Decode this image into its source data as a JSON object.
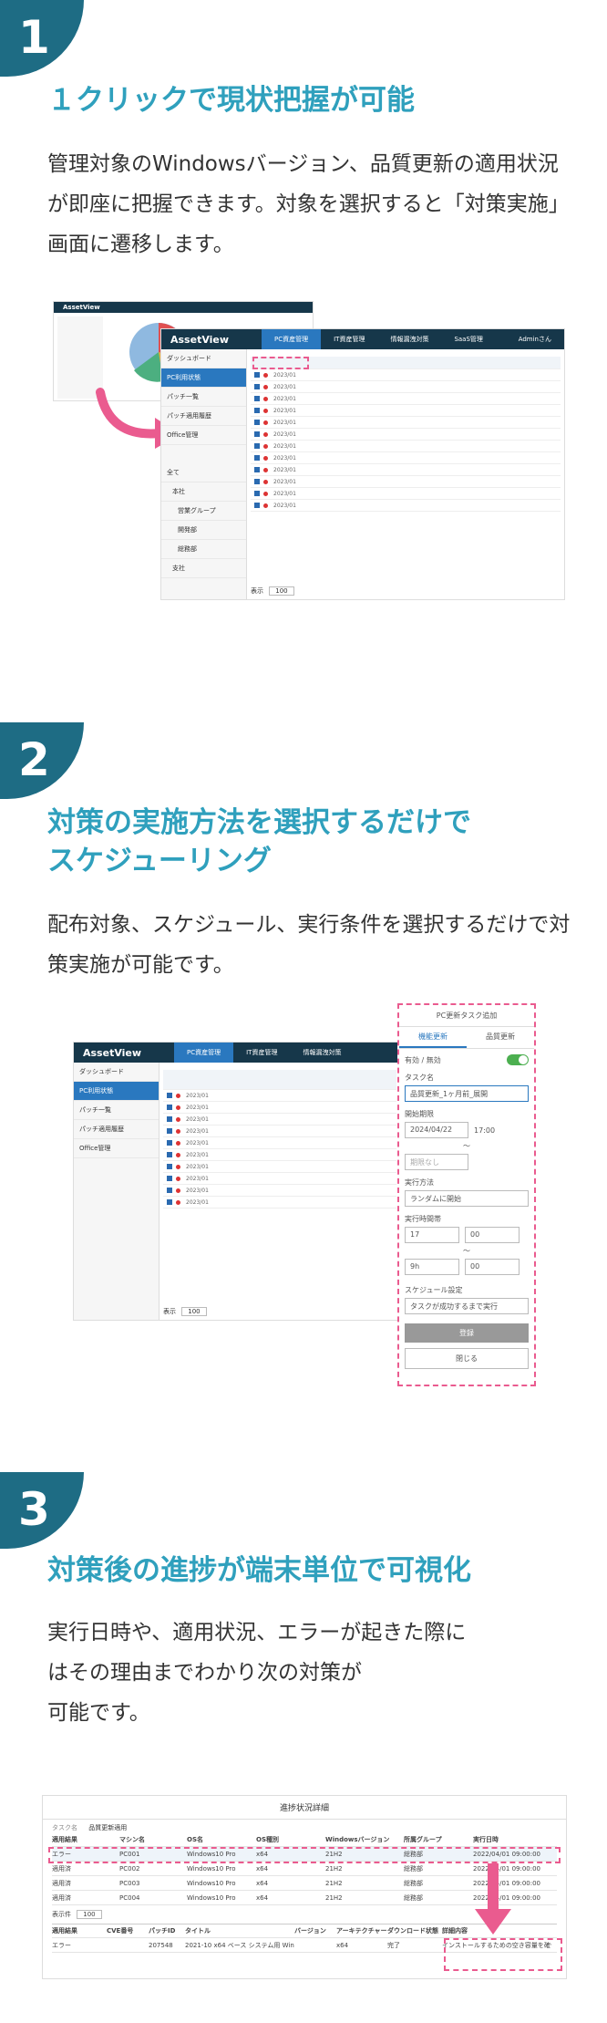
{
  "sections": [
    {
      "number": "1",
      "heading": "１クリックで現状把握が可能",
      "body": "管理対象のWindowsバージョン、品質更新の適用状況が即座に把握できます。対象を選択すると「対策実施」画面に遷移します。"
    },
    {
      "number": "2",
      "heading_line1": "対策の実施方法を選択するだけで",
      "heading_line2": "スケジューリング",
      "body": "配布対象、スケジュール、実行条件を選択するだけで対策実施が可能です。"
    },
    {
      "number": "3",
      "heading": "対策後の進捗が端末単位で可視化",
      "body_line1": "実行日時や、適用状況、エラーが起きた際に",
      "body_line2": "はその理由までわかり次の対策が",
      "body_line3": "可能です。"
    }
  ],
  "app": {
    "logo": "AssetView",
    "tabs": [
      "PC資産管理",
      "IT資産管理",
      "情報漏洩対策",
      "SaaS管理"
    ],
    "user": "Adminさん",
    "sidebar": [
      "ダッシュボード",
      "PC利用状態",
      "パッチ一覧",
      "パッチ適用履歴",
      "Office管理"
    ],
    "tree": [
      "全て",
      "本社",
      "営業グループ",
      "開発部",
      "総務部",
      "支社"
    ],
    "rows": [
      "2023/01",
      "2023/01",
      "2023/01",
      "2023/01",
      "2023/01",
      "2023/01",
      "2023/01",
      "2023/01",
      "2023/01",
      "2023/01",
      "2023/01",
      "2023/01"
    ],
    "footer_label": "表示",
    "footer_value": "100"
  },
  "task_panel": {
    "title": "PC更新タスク追加",
    "tab_active": "機能更新",
    "tab_other": "品質更新",
    "enable_label": "有効 / 無効",
    "task_name_label": "タスク名",
    "task_name_value": "品質更新_1ヶ月前_展開",
    "start_label": "開始期限",
    "start_date": "2024/04/22",
    "start_time": "17:00",
    "tilde": "〜",
    "end_placeholder": "期限なし",
    "exec_label": "実行方法",
    "exec_value": "ランダムに開始",
    "time_label": "実行時間帯",
    "hour1": "17",
    "min1": "00",
    "hour2": "9h",
    "min2": "00",
    "schedule_label": "スケジュール設定",
    "schedule_value": "タスクが成功するまで実行",
    "submit": "登録",
    "close": "閉じる"
  },
  "progress": {
    "title": "進捗状況詳細",
    "task_label": "タスク名",
    "task_value": "品質更新適用",
    "headers": [
      "適用結果",
      "マシン名",
      "OS名",
      "OS種別",
      "Windowsバージョン",
      "所属グループ",
      "実行日時"
    ],
    "rows": [
      [
        "エラー",
        "PC001",
        "Windows10 Pro",
        "x64",
        "21H2",
        "総務部",
        "2022/04/01 09:00:00"
      ],
      [
        "適用済",
        "PC002",
        "Windows10 Pro",
        "x64",
        "21H2",
        "総務部",
        "2022/04/01 09:00:00"
      ],
      [
        "適用済",
        "PC003",
        "Windows10 Pro",
        "x64",
        "21H2",
        "総務部",
        "2022/04/01 09:00:00"
      ],
      [
        "適用済",
        "PC004",
        "Windows10 Pro",
        "x64",
        "21H2",
        "総務部",
        "2022/04/01 09:00:00"
      ]
    ],
    "footer_label": "表示件",
    "footer_value": "100",
    "detail_headers": [
      "適用結果",
      "CVE番号",
      "パッチID",
      "タイトル",
      "バージョン",
      "アーキテクチャー",
      "ダウンロード状態",
      "詳細内容"
    ],
    "detail_row": [
      "エラー",
      "",
      "207548",
      "2021-10 x64 ベース システム用 Win...",
      "",
      "x64",
      "完了",
      "インストールするための空き容量を確保してください。"
    ]
  },
  "colors": {
    "accent": "#2fa0bd",
    "badge": "#1e6c84",
    "highlight": "#ea5b8f",
    "nav": "#16374a"
  }
}
